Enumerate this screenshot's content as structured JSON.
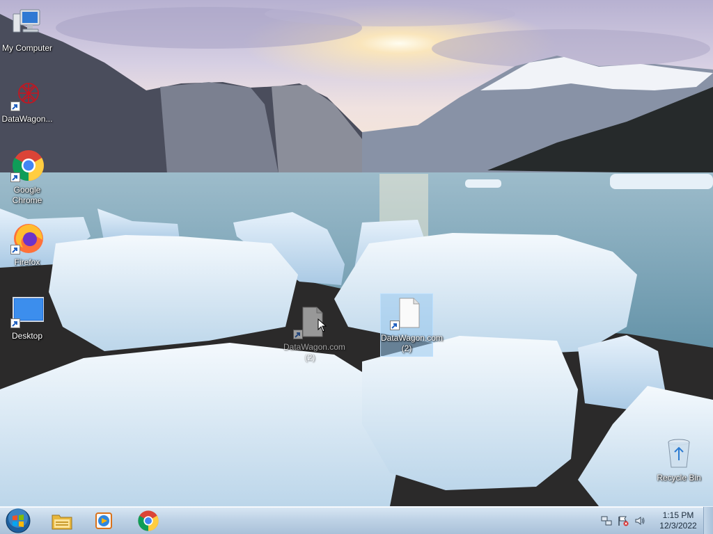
{
  "desktop": {
    "icons": [
      {
        "label": "My Computer",
        "icon": "computer-icon"
      },
      {
        "label": "DataWagon...",
        "icon": "datawagon-icon"
      },
      {
        "label": "Google Chrome",
        "icon": "chrome-icon"
      },
      {
        "label": "Firefox",
        "icon": "firefox-icon"
      },
      {
        "label": "Desktop",
        "icon": "desktop-shortcut-icon"
      },
      {
        "label": "DataWagon.com (2)",
        "icon": "file-icon"
      },
      {
        "label": "DataWagon.com (2)",
        "icon": "file-icon"
      },
      {
        "label": "Recycle Bin",
        "icon": "recycle-bin-icon"
      }
    ]
  },
  "taskbar": {
    "start": "start-orb-icon",
    "pinned": [
      {
        "name": "Windows Explorer",
        "icon": "folder-icon"
      },
      {
        "name": "Windows Media Player",
        "icon": "media-player-icon"
      },
      {
        "name": "Google Chrome",
        "icon": "chrome-icon"
      }
    ],
    "tray": {
      "icons": [
        "network-icon",
        "action-center-flag-icon",
        "volume-icon"
      ],
      "time": "1:15 PM",
      "date": "12/3/2022"
    }
  },
  "colors": {
    "taskbar": "#bfd3e6",
    "selection": "#99c9ef",
    "sky": "#c9c2dc",
    "water": "#7ea7b8"
  }
}
